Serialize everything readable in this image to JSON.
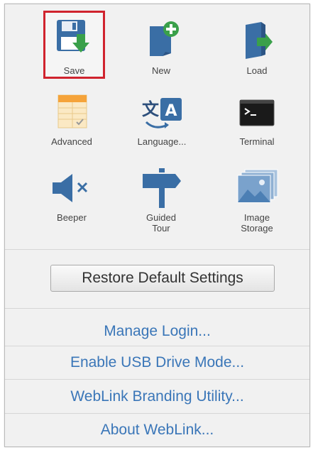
{
  "tiles": {
    "save": "Save",
    "new": "New",
    "load": "Load",
    "advanced": "Advanced",
    "language": "Language...",
    "terminal": "Terminal",
    "beeper": "Beeper",
    "guided_tour_line1": "Guided",
    "guided_tour_line2": "Tour",
    "image_storage_line1": "Image",
    "image_storage_line2": "Storage"
  },
  "icons": {
    "save": "save-floppy-icon",
    "new": "new-document-icon",
    "load": "load-folder-icon",
    "advanced": "advanced-table-icon",
    "language": "language-translate-icon",
    "terminal": "terminal-icon",
    "beeper": "speaker-mute-icon",
    "guided_tour": "signpost-icon",
    "image_storage": "image-stack-icon"
  },
  "restore_button": "Restore Default Settings",
  "links": {
    "manage_login": "Manage Login...",
    "usb_drive_mode": "Enable USB Drive Mode...",
    "branding_utility": "WebLink Branding Utility...",
    "about": "About WebLink..."
  },
  "colors": {
    "highlight": "#d0232e",
    "link": "#3a76b8",
    "icon_blue": "#3a6ea5",
    "icon_green": "#3aa04a"
  }
}
